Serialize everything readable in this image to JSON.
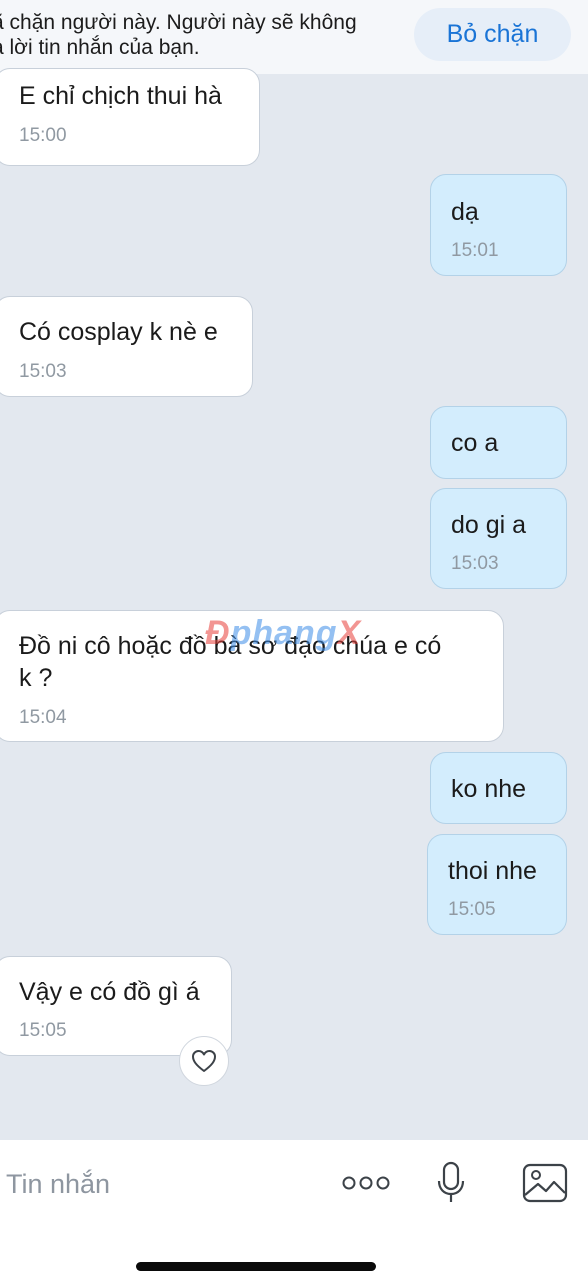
{
  "banner": {
    "line1": "ã chặn người này. Người này sẽ không",
    "line2": "à lời tin nhắn của bạn.",
    "unblock_label": "Bỏ chặn"
  },
  "messages": [
    {
      "dir": "in",
      "text": "E chỉ chịch thui hà",
      "time": "15:00"
    },
    {
      "dir": "out",
      "text": "dạ",
      "time": "15:01"
    },
    {
      "dir": "in",
      "text": "Có cosplay k nè e",
      "time": "15:03"
    },
    {
      "dir": "out",
      "text": "co a",
      "time": ""
    },
    {
      "dir": "out",
      "text": "do gi a",
      "time": "15:03"
    },
    {
      "dir": "in",
      "text_line1": "Đồ ni cô hoặc đồ bà sơ đạo chúa e có",
      "text_line2": "k ?",
      "time": "15:04"
    },
    {
      "dir": "out",
      "text": "ko nhe",
      "time": ""
    },
    {
      "dir": "out",
      "text": "thoi nhe",
      "time": "15:05"
    },
    {
      "dir": "in",
      "text": "Vậy e có đồ gì á",
      "time": "15:05"
    }
  ],
  "watermark": {
    "part1": "Đ",
    "part2": "phang",
    "part3": "X"
  },
  "input": {
    "placeholder": "Tin nhắn"
  },
  "icons": {
    "heart": "heart-icon",
    "more": "more-dots-icon",
    "mic": "microphone-icon",
    "image": "image-icon"
  },
  "colors": {
    "accent": "#1a74d6",
    "incoming_bubble": "#ffffff",
    "outgoing_bubble": "#d3edfd",
    "background": "#e3e8ef"
  }
}
